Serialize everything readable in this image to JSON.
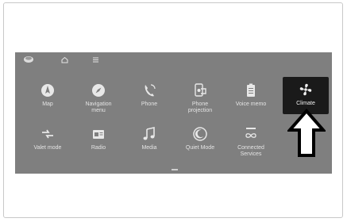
{
  "topbar": {
    "icons": [
      "profile-icon",
      "home-icon",
      "menu-icon"
    ]
  },
  "tiles": [
    {
      "label": "Map",
      "icon": "map-icon"
    },
    {
      "label": "Navigation\nmenu",
      "icon": "compass-icon"
    },
    {
      "label": "Phone",
      "icon": "phone-icon"
    },
    {
      "label": "Phone\nprojection",
      "icon": "phone-projection-icon"
    },
    {
      "label": "Voice memo",
      "icon": "voice-memo-icon"
    },
    {
      "label": "Climate",
      "icon": "fan-icon"
    },
    {
      "label": "Valet mode",
      "icon": "valet-icon"
    },
    {
      "label": "Radio",
      "icon": "radio-icon"
    },
    {
      "label": "Media",
      "icon": "music-note-icon"
    },
    {
      "label": "Quiet Mode",
      "icon": "quiet-mode-icon"
    },
    {
      "label": "Connected\nServices",
      "icon": "connected-services-icon"
    }
  ],
  "selected_tile": "Climate",
  "colors": {
    "screen_bg": "#7f7f7f",
    "selected_bg": "#1a1a1a",
    "text": "#e4e4e4"
  }
}
